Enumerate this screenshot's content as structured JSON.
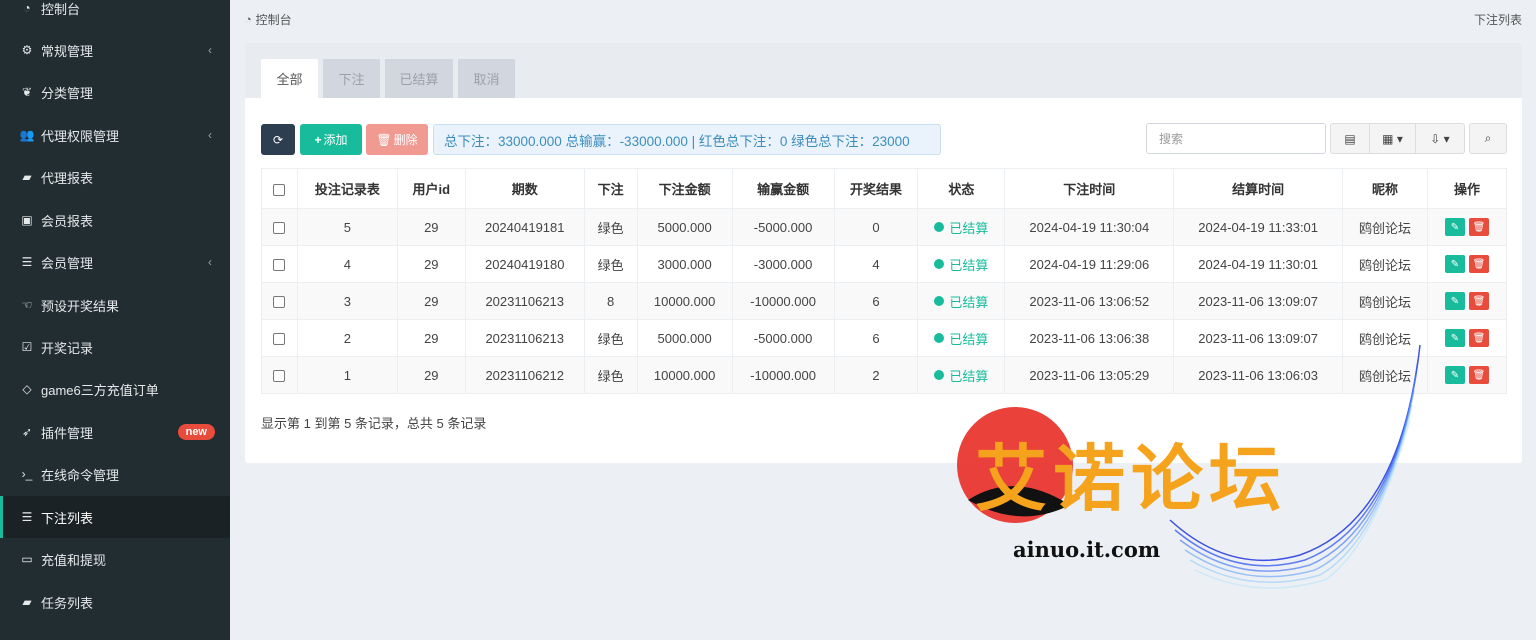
{
  "sidebar": {
    "items": [
      {
        "label": "控制台",
        "icon": "dashboard-icon",
        "glyph": "◔"
      },
      {
        "label": "常规管理",
        "icon": "cogs-icon",
        "glyph": "⚙",
        "chevron": "‹"
      },
      {
        "label": "分类管理",
        "icon": "leaf-icon",
        "glyph": "❦"
      },
      {
        "label": "代理权限管理",
        "icon": "group-icon",
        "glyph": "👥",
        "chevron": "‹"
      },
      {
        "label": "代理报表",
        "icon": "book-icon",
        "glyph": "▰"
      },
      {
        "label": "会员报表",
        "icon": "user-card-icon",
        "glyph": "▣"
      },
      {
        "label": "会员管理",
        "icon": "list-icon",
        "glyph": "☰",
        "chevron": "‹"
      },
      {
        "label": "预设开奖结果",
        "icon": "hand-icon",
        "glyph": "☜"
      },
      {
        "label": "开奖记录",
        "icon": "calendar-check-icon",
        "glyph": "☑"
      },
      {
        "label": "game6三方充值订单",
        "icon": "diamond-icon",
        "glyph": "◇"
      },
      {
        "label": "插件管理",
        "icon": "rocket-icon",
        "glyph": "➶",
        "badge": "new"
      },
      {
        "label": "在线命令管理",
        "icon": "terminal-icon",
        "glyph": "›_"
      },
      {
        "label": "下注列表",
        "icon": "list-icon",
        "glyph": "☰",
        "active": true
      },
      {
        "label": "充值和提现",
        "icon": "money-icon",
        "glyph": "▭"
      },
      {
        "label": "任务列表",
        "icon": "book-icon",
        "glyph": "▰"
      }
    ]
  },
  "breadcrumb": {
    "label": "控制台"
  },
  "page_title": "下注列表",
  "tabs": [
    "全部",
    "下注",
    "已结算",
    "取消"
  ],
  "toolbar": {
    "add_label": "添加",
    "delete_label": "删除",
    "summary": "总下注：33000.000 总输赢：-33000.000 | 红色总下注：0 绿色总下注：23000",
    "search_placeholder": "搜索"
  },
  "table": {
    "headers": [
      "投注记录表",
      "用户id",
      "期数",
      "下注",
      "下注金额",
      "输赢金额",
      "开奖结果",
      "状态",
      "下注时间",
      "结算时间",
      "昵称",
      "操作"
    ],
    "rows": [
      {
        "id": "5",
        "uid": "29",
        "period": "20240419181",
        "bet": "绿色",
        "amount": "5000.000",
        "winloss": "-5000.000",
        "result": "0",
        "status": "已结算",
        "bet_time": "2024-04-19 11:30:04",
        "settle_time": "2024-04-19 11:33:01",
        "nick": "鸥创论坛"
      },
      {
        "id": "4",
        "uid": "29",
        "period": "20240419180",
        "bet": "绿色",
        "amount": "3000.000",
        "winloss": "-3000.000",
        "result": "4",
        "status": "已结算",
        "bet_time": "2024-04-19 11:29:06",
        "settle_time": "2024-04-19 11:30:01",
        "nick": "鸥创论坛"
      },
      {
        "id": "3",
        "uid": "29",
        "period": "20231106213",
        "bet": "8",
        "bet_link": true,
        "amount": "10000.000",
        "winloss": "-10000.000",
        "result": "6",
        "status": "已结算",
        "bet_time": "2023-11-06 13:06:52",
        "settle_time": "2023-11-06 13:09:07",
        "nick": "鸥创论坛"
      },
      {
        "id": "2",
        "uid": "29",
        "period": "20231106213",
        "bet": "绿色",
        "amount": "5000.000",
        "winloss": "-5000.000",
        "result": "6",
        "status": "已结算",
        "bet_time": "2023-11-06 13:06:38",
        "settle_time": "2023-11-06 13:09:07",
        "nick": "鸥创论坛"
      },
      {
        "id": "1",
        "uid": "29",
        "period": "20231106212",
        "bet": "绿色",
        "amount": "10000.000",
        "winloss": "-10000.000",
        "result": "2",
        "status": "已结算",
        "bet_time": "2023-11-06 13:05:29",
        "settle_time": "2023-11-06 13:06:03",
        "nick": "鸥创论坛"
      }
    ]
  },
  "pagination_info": "显示第 1 到第 5 条记录，总共 5 条记录",
  "watermark": {
    "title": "艾诺论坛",
    "url": "ainuo.it.com"
  },
  "colors": {
    "sidebar_bg": "#222d32",
    "accent": "#18bc9c",
    "danger": "#e74c3c",
    "primary_dark": "#2c3e50",
    "link": "#3c8dbc",
    "watermark": "#f5a21c"
  }
}
